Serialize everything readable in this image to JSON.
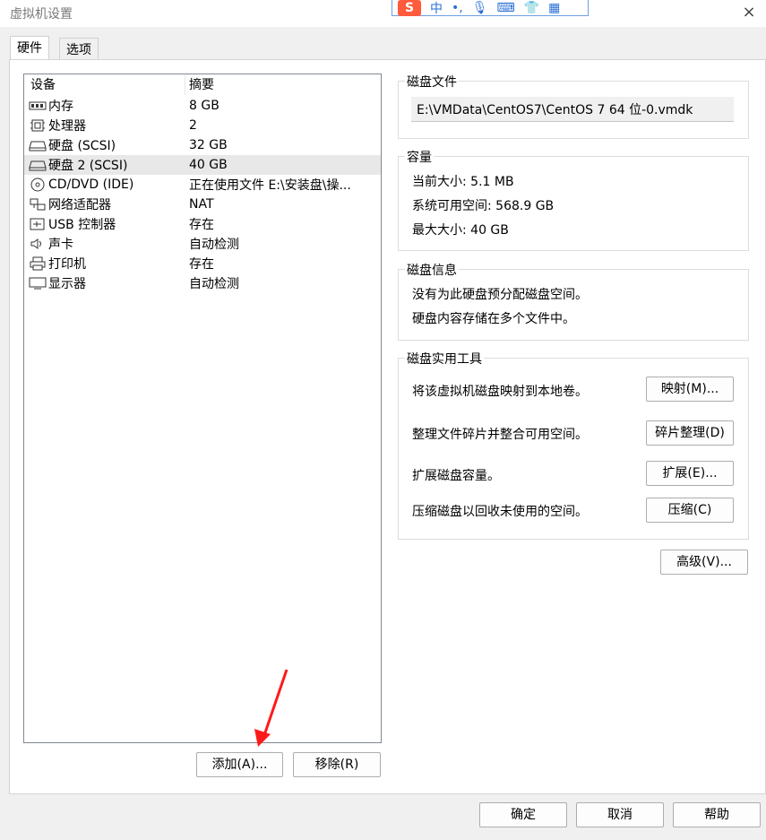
{
  "window": {
    "title": "虚拟机设置",
    "close_glyph": "×"
  },
  "ime": {
    "logo": "S",
    "label": "中",
    "punct": "•,",
    "mic": "🎙",
    "keyboard": "⌨",
    "shirt": "👕",
    "grid": "▦"
  },
  "tabs": [
    {
      "label": "硬件"
    },
    {
      "label": "选项"
    }
  ],
  "device_list": {
    "header": {
      "device": "设备",
      "summary": "摘要"
    },
    "rows": [
      {
        "icon": "memory-icon",
        "name": "内存",
        "summary": "8 GB"
      },
      {
        "icon": "processor-icon",
        "name": "处理器",
        "summary": "2"
      },
      {
        "icon": "hard-disk-icon",
        "name": "硬盘 (SCSI)",
        "summary": "32 GB"
      },
      {
        "icon": "hard-disk-icon",
        "name": "硬盘 2 (SCSI)",
        "summary": "40 GB",
        "selected": true
      },
      {
        "icon": "cd-dvd-icon",
        "name": "CD/DVD (IDE)",
        "summary": "正在使用文件 E:\\安装盘\\操..."
      },
      {
        "icon": "network-adapter-icon",
        "name": "网络适配器",
        "summary": "NAT"
      },
      {
        "icon": "usb-icon",
        "name": "USB 控制器",
        "summary": "存在"
      },
      {
        "icon": "sound-icon",
        "name": "声卡",
        "summary": "自动检测"
      },
      {
        "icon": "printer-icon",
        "name": "打印机",
        "summary": "存在"
      },
      {
        "icon": "display-icon",
        "name": "显示器",
        "summary": "自动检测"
      }
    ]
  },
  "list_buttons": {
    "add": "添加(A)...",
    "remove": "移除(R)"
  },
  "disk_file": {
    "title": "磁盘文件",
    "path": "E:\\VMData\\CentOS7\\CentOS 7 64 位-0.vmdk"
  },
  "capacity": {
    "title": "容量",
    "current": "当前大小: 5.1 MB",
    "available": "系统可用空间: 568.9 GB",
    "max": "最大大小: 40 GB"
  },
  "disk_info": {
    "title": "磁盘信息",
    "line1": "没有为此硬盘预分配磁盘空间。",
    "line2": "硬盘内容存储在多个文件中。"
  },
  "disk_tools": {
    "title": "磁盘实用工具",
    "map_text": "将该虚拟机磁盘映射到本地卷。",
    "map_button": "映射(M)...",
    "defrag_text": "整理文件碎片并整合可用空间。",
    "defrag_button": "碎片整理(D)",
    "expand_text": "扩展磁盘容量。",
    "expand_button": "扩展(E)...",
    "compact_text": "压缩磁盘以回收未使用的空间。",
    "compact_button": "压缩(C)"
  },
  "advanced_button": "高级(V)...",
  "footer": {
    "ok": "确定",
    "cancel": "取消",
    "help": "帮助"
  },
  "colors": {
    "selected_row": "#e8e8e8",
    "annotation_arrow": "#ff1a1a",
    "ime_accent": "#2b6fd6"
  }
}
